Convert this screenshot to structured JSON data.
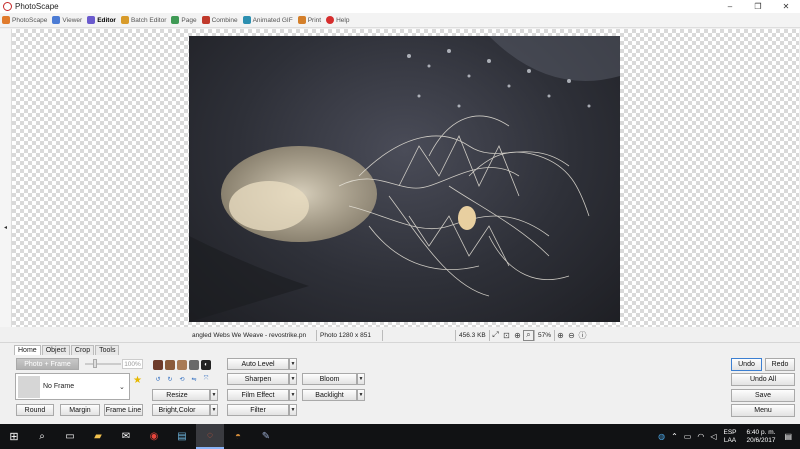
{
  "window": {
    "title": "PhotoScape",
    "minimize": "–",
    "maximize": "❐",
    "close": "✕"
  },
  "tabs": [
    {
      "label": "PhotoScape",
      "icon": "photoscape-icon",
      "color": "#e07b2d"
    },
    {
      "label": "Viewer",
      "icon": "viewer-icon",
      "color": "#4b7bd4"
    },
    {
      "label": "Editor",
      "icon": "editor-icon",
      "color": "#6a5acd"
    },
    {
      "label": "Batch Editor",
      "icon": "batch-editor-icon",
      "color": "#d89b2a"
    },
    {
      "label": "Page",
      "icon": "page-icon",
      "color": "#3f9a55"
    },
    {
      "label": "Combine",
      "icon": "combine-icon",
      "color": "#c0392b"
    },
    {
      "label": "Animated GIF",
      "icon": "animated-gif-icon",
      "color": "#2c8fb0"
    },
    {
      "label": "Print",
      "icon": "print-icon",
      "color": "#d47f2a"
    },
    {
      "label": "Help",
      "icon": "help-icon",
      "color": "#d62d2d"
    }
  ],
  "status": {
    "filename": "angled Webs We Weave - revostrike.pn",
    "photo_size": "Photo 1280 x 851",
    "file_size": "456.3 KB",
    "zoom": "57%"
  },
  "panel": {
    "tabs": [
      "Home",
      "Object",
      "Crop",
      "Tools"
    ],
    "photo_frame": "Photo + Frame",
    "opacity": "100%",
    "frame_select": "No Frame",
    "round": "Round",
    "margin": "Margin",
    "frame_line": "Frame Line",
    "resize": "Resize",
    "bright_color": "Bright,Color",
    "auto_level": "Auto Level",
    "sharpen": "Sharpen",
    "film_effect": "Film Effect",
    "filter": "Filter",
    "bloom": "Bloom",
    "backlight": "Backlight",
    "undo": "Undo",
    "redo": "Redo",
    "undo_all": "Undo All",
    "save": "Save",
    "menu": "Menu"
  },
  "taskbar": {
    "lang_top": "ESP",
    "lang_bottom": "LAA",
    "time": "6:40 p. m.",
    "date": "20/6/2017"
  }
}
